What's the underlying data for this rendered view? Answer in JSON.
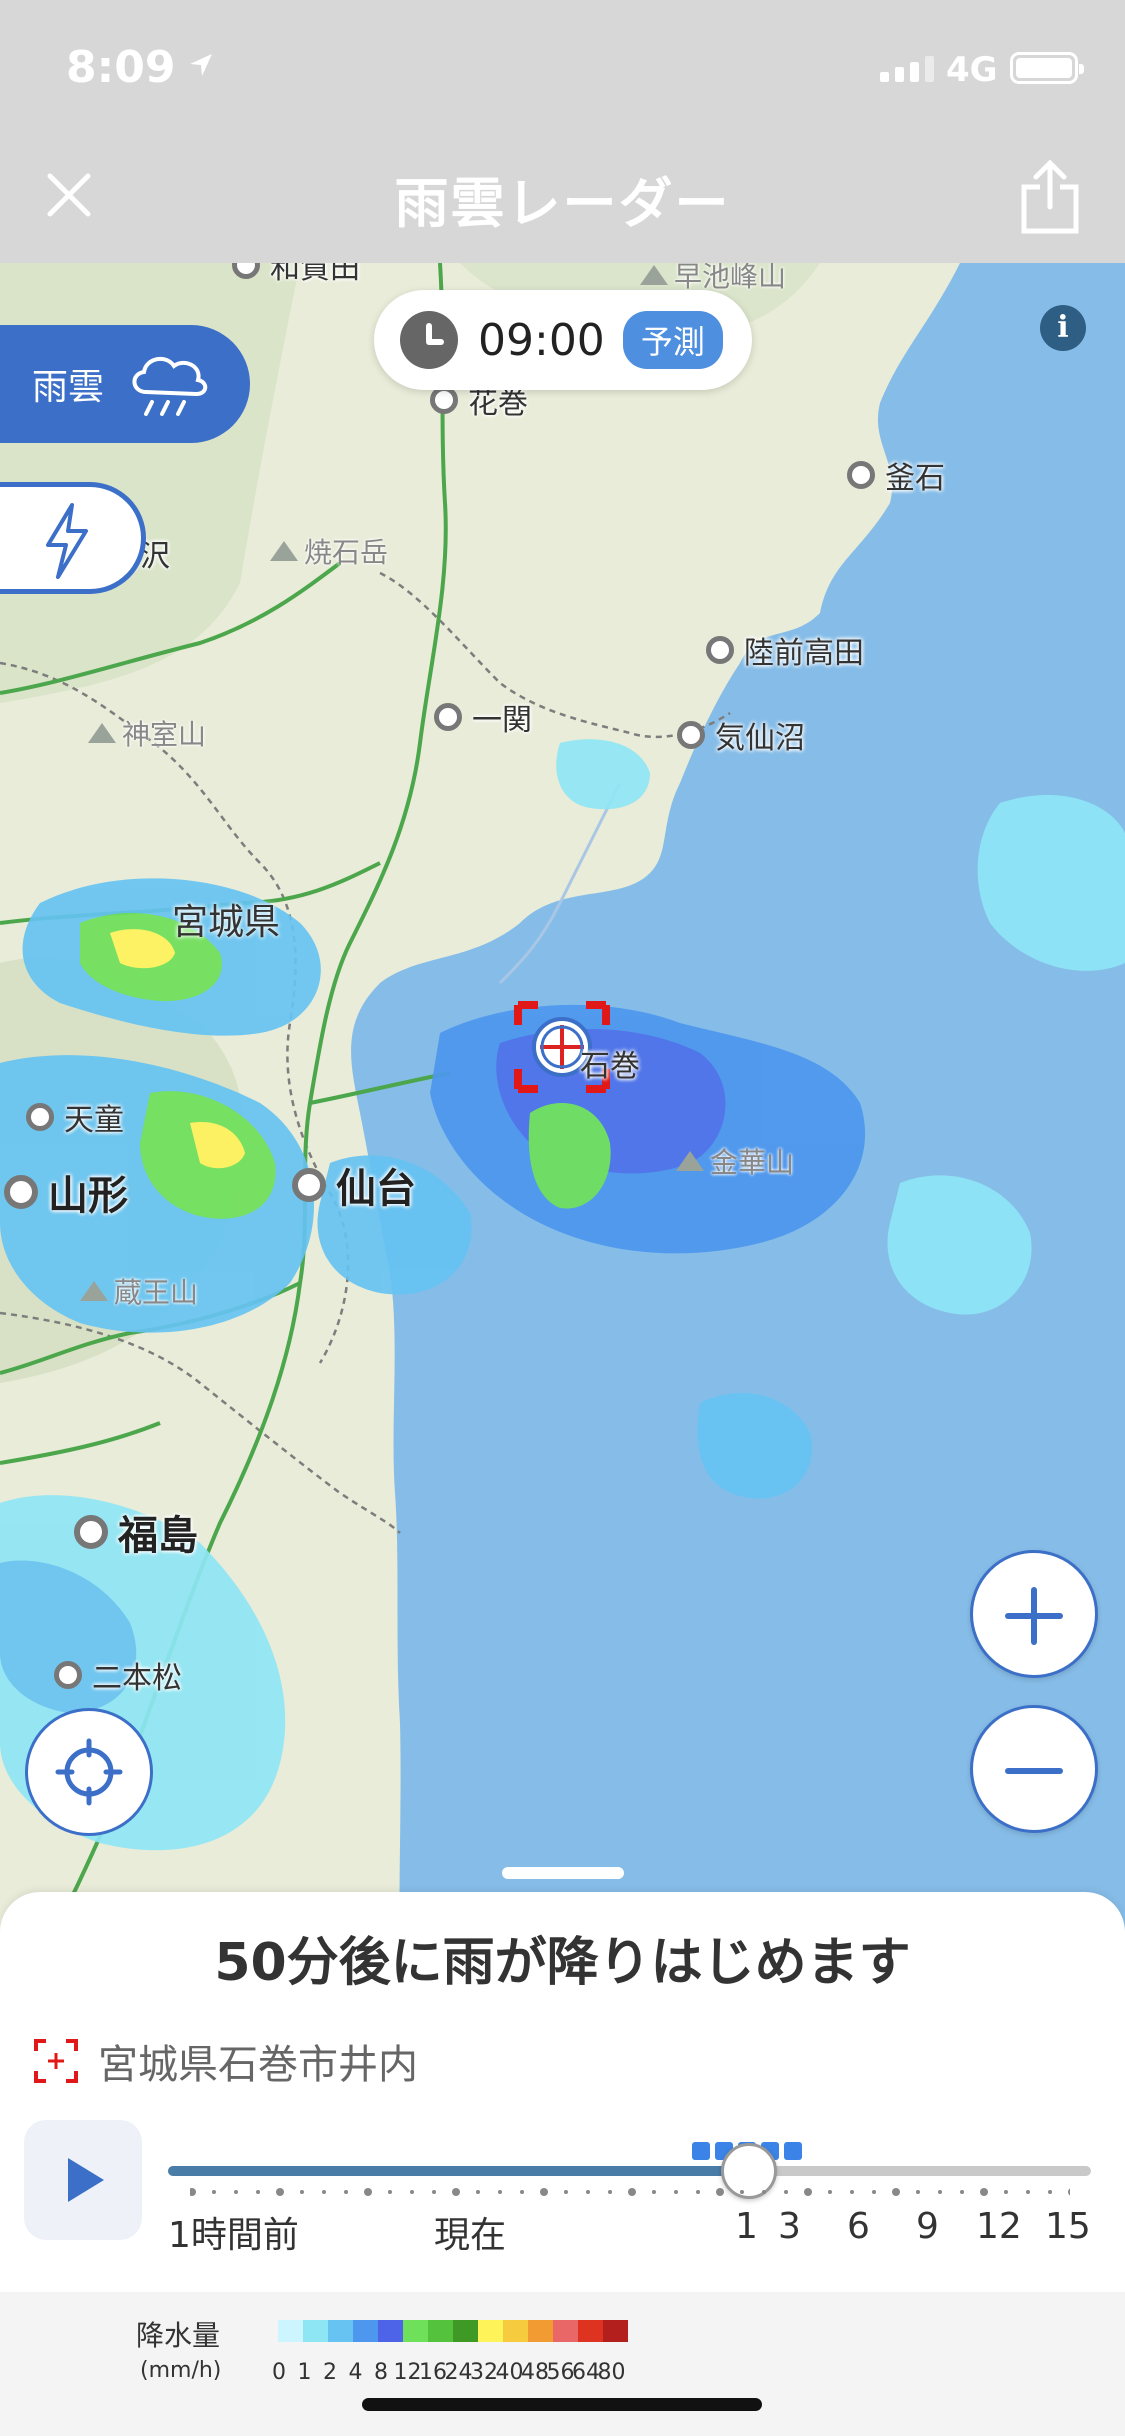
{
  "status_bar": {
    "time": "8:09",
    "network": "4G"
  },
  "nav": {
    "title": "雨雲レーダー"
  },
  "time_control": {
    "time": "09:00",
    "badge": "予測"
  },
  "layers": {
    "rain_label": "雨雲"
  },
  "map": {
    "places_partial": [
      {
        "label": "和賀田"
      },
      {
        "label": "花巻"
      },
      {
        "label": "湯沢"
      }
    ],
    "places": [
      {
        "label": "釜石"
      },
      {
        "label": "陸前高田"
      },
      {
        "label": "一関"
      },
      {
        "label": "気仙沼"
      },
      {
        "label": "天童"
      },
      {
        "label": "二本松"
      },
      {
        "label": "石巻"
      }
    ],
    "big_places": [
      {
        "label": "山形"
      },
      {
        "label": "仙台"
      },
      {
        "label": "福島"
      }
    ],
    "mountains": [
      {
        "label": "早池峰山"
      },
      {
        "label": "焼石岳"
      },
      {
        "label": "神室山"
      },
      {
        "label": "蔵王山"
      },
      {
        "label": "金華山"
      }
    ],
    "prefecture": "宮城県"
  },
  "sheet": {
    "headline": "50分後に雨が降りはじめます",
    "location": "宮城県石巻市井内",
    "slider": {
      "position_fraction": 0.63,
      "labels": [
        "1時間前",
        "現在",
        "1",
        "3",
        "6",
        "9",
        "12",
        "15"
      ]
    }
  },
  "legend": {
    "title": "降水量",
    "unit": "(mm/h)",
    "values": [
      "0",
      "1",
      "2",
      "4",
      "8",
      "12",
      "16",
      "24",
      "32",
      "40",
      "48",
      "56",
      "64",
      "80"
    ],
    "colors": [
      "#ccf5ff",
      "#8ee6f5",
      "#66c3f2",
      "#4d97ee",
      "#4d63e8",
      "#6ee05a",
      "#54c23c",
      "#3f9a25",
      "#fff35a",
      "#f6cc3e",
      "#f19b32",
      "#e96767",
      "#df3322",
      "#b31f1c"
    ]
  }
}
